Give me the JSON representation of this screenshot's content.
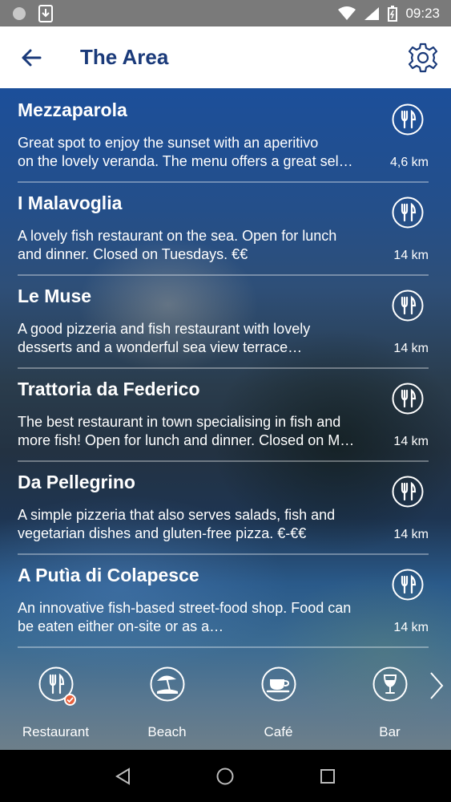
{
  "status_bar": {
    "time": "09:23"
  },
  "header": {
    "title": "The Area"
  },
  "icons": {
    "back": "arrow-left-icon",
    "settings": "gear-icon",
    "place": "fork-knife-icon",
    "next": "chevron-right-icon"
  },
  "places": [
    {
      "name": "Mezzaparola",
      "desc_line1": "Great spot to enjoy the sunset with an aperitivo",
      "desc_line2": "on the lovely veranda. The menu offers a great sel…",
      "distance": "4,6 km"
    },
    {
      "name": "I Malavoglia",
      "desc_line1": "A lovely fish restaurant on the sea. Open for lunch",
      "desc_line2": "and dinner. Closed on Tuesdays. €€",
      "distance": "14 km"
    },
    {
      "name": "Le Muse",
      "desc_line1": "A good pizzeria and fish restaurant with lovely",
      "desc_line2": "desserts and a wonderful sea view terrace…",
      "distance": "14 km"
    },
    {
      "name": "Trattoria da Federico",
      "desc_line1": "The best restaurant in town specialising in fish and",
      "desc_line2": "more fish! Open for lunch and dinner. Closed on M…",
      "distance": "14 km"
    },
    {
      "name": "Da Pellegrino",
      "desc_line1": "A simple pizzeria that also serves salads, fish and",
      "desc_line2": "vegetarian dishes and gluten-free pizza. €-€€",
      "distance": "14 km"
    },
    {
      "name": "A Putìa di Colapesce",
      "desc_line1": "An innovative fish-based street-food shop. Food can",
      "desc_line2": "be eaten either on-site or as a…",
      "distance": "14 km"
    }
  ],
  "categories": [
    {
      "label": "Restaurant",
      "icon": "fork-knife-icon",
      "selected": true
    },
    {
      "label": "Beach",
      "icon": "beach-umbrella-icon",
      "selected": false
    },
    {
      "label": "Café",
      "icon": "coffee-cup-icon",
      "selected": false
    },
    {
      "label": "Bar",
      "icon": "wine-glass-icon",
      "selected": false
    }
  ],
  "colors": {
    "accent": "#1a3a7a",
    "badge": "#e8603c"
  }
}
